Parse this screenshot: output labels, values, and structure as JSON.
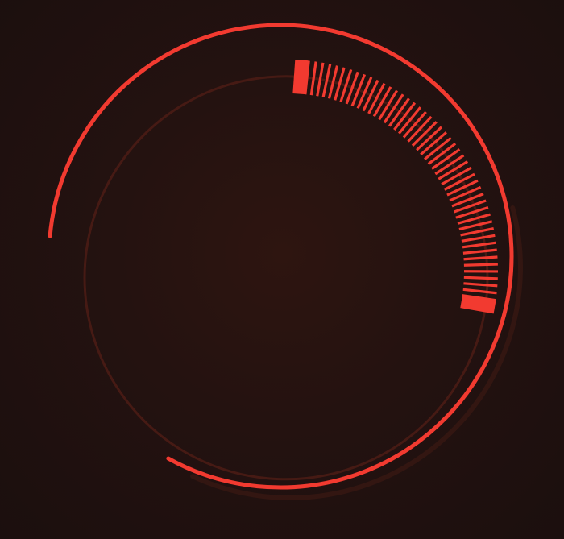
{
  "colors": {
    "background": "#1d1010",
    "glow": "#2e1510",
    "accent": "#f23a30",
    "inner_ring": "#4a1c15",
    "shadow_ring": "#3a1813"
  },
  "hud": {
    "segment_count": 50,
    "icons": {
      "outer_arc": "outer-arc-icon",
      "inner_ring": "inner-ring-icon",
      "segment_gauge": "segment-gauge-icon"
    }
  }
}
